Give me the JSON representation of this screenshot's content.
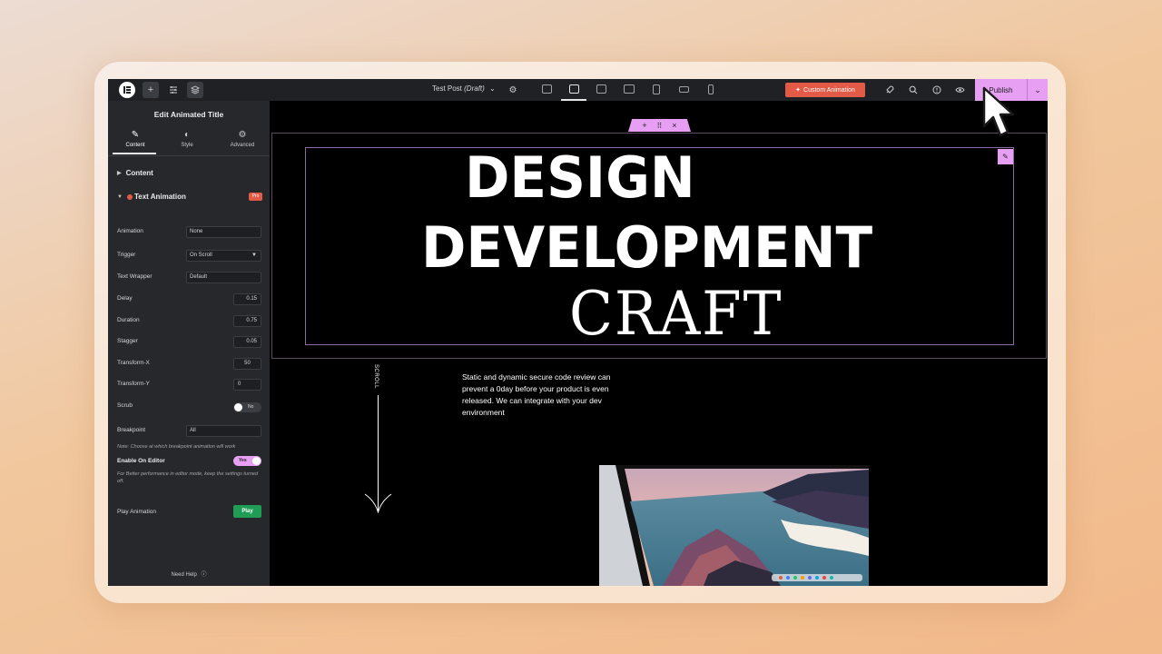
{
  "topbar": {
    "document_title": "Test Post",
    "document_status": "(Draft)",
    "custom_animation_label": "Custom Animation",
    "publish_label": "Publish"
  },
  "sidebar": {
    "title": "Edit Animated Title",
    "tabs": [
      {
        "label": "Content"
      },
      {
        "label": "Style"
      },
      {
        "label": "Advanced"
      }
    ],
    "content_section": "Content",
    "text_animation_section": "Text Animation",
    "pro_badge": "Pro",
    "fields": {
      "animation": {
        "label": "Animation",
        "value": "None"
      },
      "trigger": {
        "label": "Trigger",
        "value": "On Scroll"
      },
      "text_wrapper": {
        "label": "Text Wrapper",
        "value": "Default"
      },
      "delay": {
        "label": "Delay",
        "value": "0.15"
      },
      "duration": {
        "label": "Duration",
        "value": "0.75"
      },
      "stagger": {
        "label": "Stagger",
        "value": "0.05"
      },
      "transform_x": {
        "label": "Transform-X",
        "value": "50"
      },
      "transform_y": {
        "label": "Transform-Y",
        "value": "0"
      },
      "scrub": {
        "label": "Scrub",
        "value": "No"
      },
      "breakpoint": {
        "label": "Breakpoint",
        "value": "All"
      },
      "enable_on_editor": {
        "label": "Enable On Editor",
        "value": "Yes"
      }
    },
    "breakpoint_note": "Note: Choose at which breakpoint animation will work",
    "editor_note": "For Better performance in editor mode, keep the settings turned off.",
    "play_animation_label": "Play Animation",
    "play_button": "Play",
    "need_help": "Need Help"
  },
  "canvas": {
    "hero_line1": "DESIGN",
    "hero_line2": "DEVELOPMENT",
    "hero_line3": "CRAFT",
    "scroll_label": "SCROLL",
    "body_text": "Static and dynamic secure code review can prevent a 0day before your product is even released. We can integrate with your dev environment"
  },
  "colors": {
    "accent_pink": "#e79ff3",
    "custom_animation_red": "#e35a46",
    "play_green": "#1f9d55",
    "sidebar_bg": "#26282b",
    "topbar_bg": "#1f2124"
  }
}
